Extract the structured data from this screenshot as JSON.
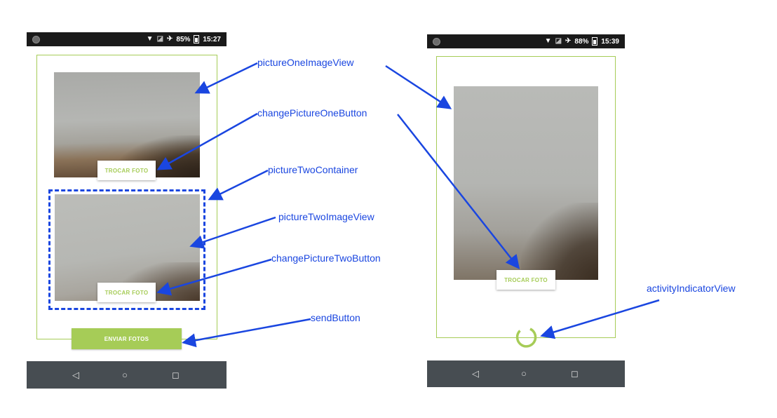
{
  "left_phone": {
    "status_bar": {
      "battery": "85%",
      "time": "15:27"
    },
    "picture_one_button": "TROCAR FOTO",
    "picture_two_button": "TROCAR FOTO",
    "send_button": "ENVIAR FOTOS"
  },
  "right_phone": {
    "status_bar": {
      "battery": "88%",
      "time": "15:39"
    },
    "change_picture_button": "TROCAR FOTO"
  },
  "annotations": {
    "picture_one_image_view": "pictureOneImageView",
    "change_picture_one_button": "changePictureOneButton",
    "picture_two_container": "pictureTwoContainer",
    "picture_two_image_view": "pictureTwoImageView",
    "change_picture_two_button": "changePictureTwoButton",
    "send_button": "sendButton",
    "activity_indicator_view": "activityIndicatorView"
  },
  "colors": {
    "accent_green": "#a6cc57",
    "annotation_blue": "#1a46e0",
    "nav_bar": "#474d52",
    "status_bar": "#1a1a1a"
  },
  "icons": [
    "camera-dot-icon",
    "wifi-icon",
    "no-sim-icon",
    "airplane-icon",
    "battery-icon",
    "back-triangle-icon",
    "home-circle-icon",
    "recents-square-icon",
    "spinner-icon",
    "arrow-icon"
  ]
}
